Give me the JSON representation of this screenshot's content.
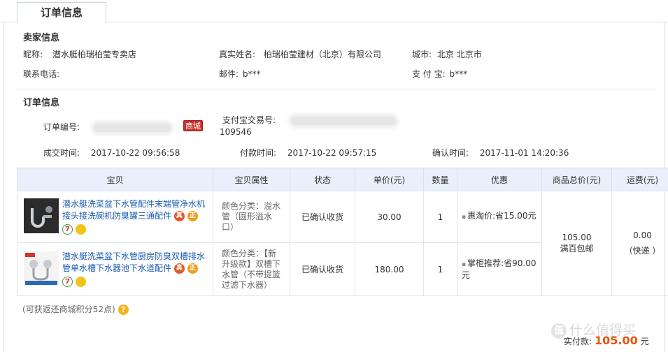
{
  "tab": {
    "label": "订单信息"
  },
  "seller": {
    "section_title": "卖家信息",
    "nickname_label": "昵称:",
    "nickname": "潜水艇柏瑞柏莹专卖店",
    "realname_label": "真实姓名:",
    "realname": "柏瑞柏莹建材（北京）有限公司",
    "city_label": "城市:",
    "city": "北京 北京市",
    "phone_label": "联系电话:",
    "email_label": "邮件:",
    "email": "b***",
    "alipay_label": "支 付 宝:",
    "alipay": "b***"
  },
  "order": {
    "section_title": "订单信息",
    "order_no_label": "订单编号:",
    "mall_badge": "商城",
    "alipay_trade_label": "支付宝交易号:",
    "alipay_trade_suffix": "109546",
    "deal_time_label": "成交时间:",
    "deal_time": "2017-10-22 09:56:58",
    "pay_time_label": "付款时间:",
    "pay_time": "2017-10-22 09:57:15",
    "confirm_time_label": "确认时间:",
    "confirm_time": "2017-11-01 14:20:36"
  },
  "table": {
    "headers": [
      "宝贝",
      "宝贝属性",
      "状态",
      "单价(元)",
      "数量",
      "优惠",
      "商品总价(元)",
      "运费(元)"
    ],
    "items": [
      {
        "title": "潜水艇洗菜盆下水管配件末端管净水机接头接洗碗机防臭罐三通配件",
        "attr": "颜色分类：溢水管（圆形溢水口）",
        "status": "已确认收货",
        "price": "30.00",
        "qty": "1",
        "discount": "惠淘价:省15.00元"
      },
      {
        "title": "潜水艇洗菜盆下水管厨房防臭双槽排水管单水槽下水器池下水道配件",
        "attr": "颜色分类：【新升级款】双槽下水管（不带提篮过滤下水器）",
        "status": "已确认收货",
        "price": "180.00",
        "qty": "1",
        "discount": "掌柜推荐:省90.00元"
      }
    ],
    "total": "105.00",
    "total_note": "满百包邮",
    "shipping": "0.00",
    "shipping_note": "（快递 ）",
    "icons": {
      "zhen": "真",
      "zheng": "正",
      "seven": "7"
    }
  },
  "points_text": "(可获返还商城积分52点)",
  "help_icon": "?",
  "payment": {
    "label": "实付款:",
    "amount": "105.00",
    "unit": "元"
  },
  "watermark": {
    "badge": "值",
    "text": "什么值得买"
  }
}
